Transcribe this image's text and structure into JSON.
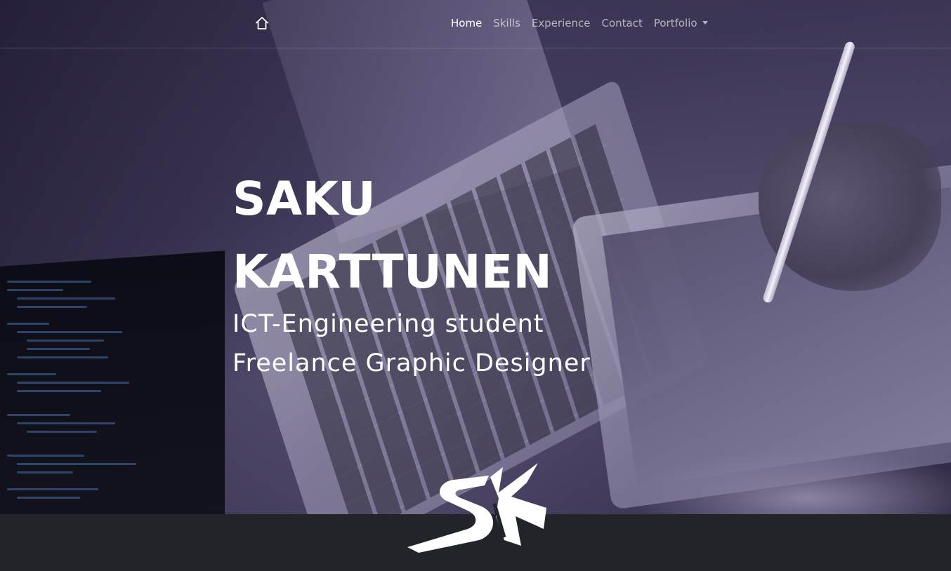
{
  "nav": {
    "home_icon": "home-icon",
    "links": [
      {
        "label": "Home",
        "active": true
      },
      {
        "label": "Skills",
        "active": false
      },
      {
        "label": "Experience",
        "active": false
      },
      {
        "label": "Contact",
        "active": false
      }
    ],
    "dropdown": {
      "label": "Portfolio",
      "icon": "caret-down-icon"
    }
  },
  "hero": {
    "name_line1": "SAKU",
    "name_line2": "KARTTUNEN",
    "subtitle_line1": "ICT-Engineering student",
    "subtitle_line2": "Freelance Graphic Designer"
  },
  "logo": {
    "icon": "sk-logo"
  },
  "colors": {
    "footer": "#212529",
    "text": "#ffffff",
    "nav_inactive": "rgba(255,255,255,0.62)"
  }
}
